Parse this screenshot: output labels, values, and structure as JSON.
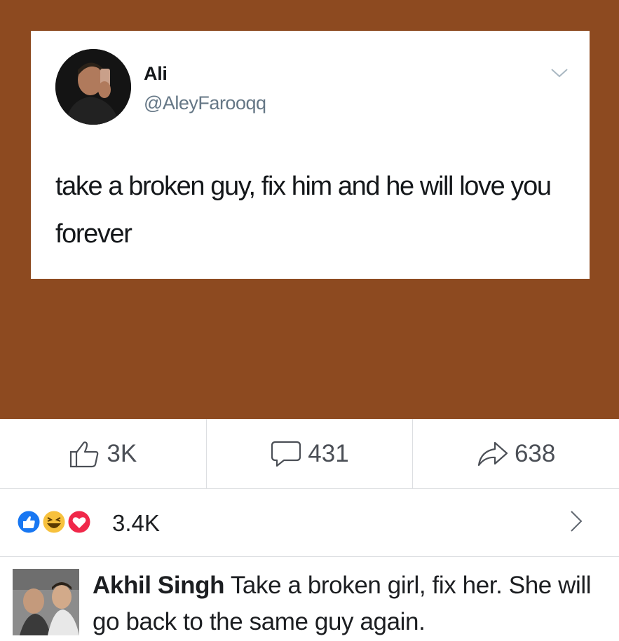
{
  "tweet": {
    "name": "Ali",
    "handle": "@AleyFarooqq",
    "text": "take a broken guy, fix him and he will love you forever"
  },
  "actions": {
    "like_count": "3K",
    "comment_count": "431",
    "share_count": "638"
  },
  "reactions": {
    "count": "3.4K",
    "icons": [
      "like-reaction",
      "haha-reaction",
      "love-reaction"
    ]
  },
  "comment": {
    "author": "Akhil Singh",
    "text": "Take a broken girl, fix her. She will go back to the same guy again."
  },
  "colors": {
    "post_background": "#8d4a20",
    "like_blue": "#1877f2",
    "haha_yellow": "#f7c13d",
    "love_red": "#f0284a"
  }
}
